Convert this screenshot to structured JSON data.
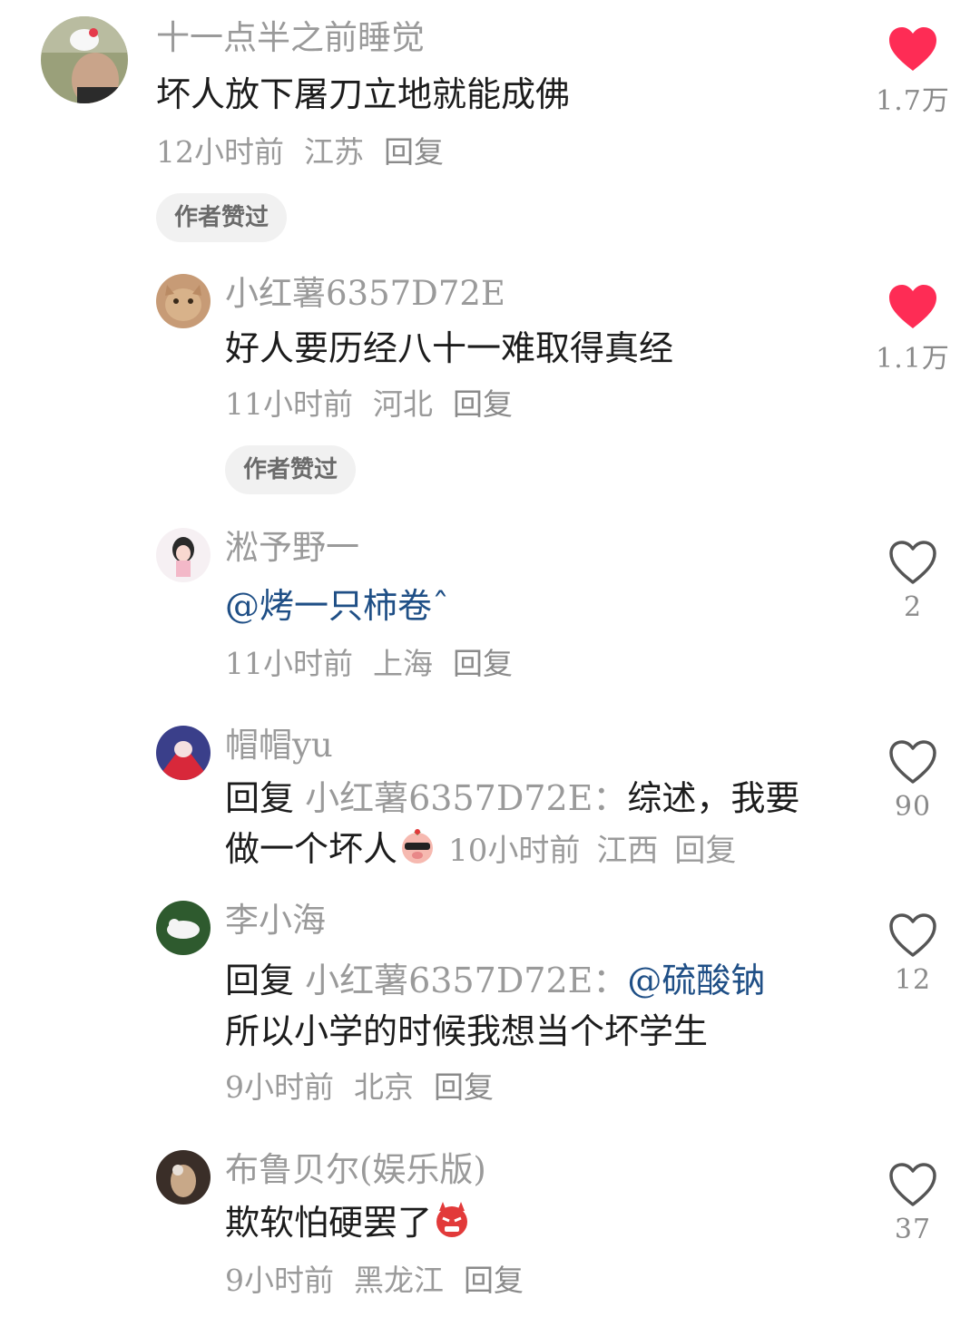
{
  "comments": [
    {
      "username": "十一点半之前睡觉",
      "text": "坏人放下屠刀立地就能成佛",
      "time": "12小时前",
      "location": "江苏",
      "reply": "回复",
      "badge": "作者赞过",
      "likes": "1.7万",
      "liked": true
    },
    {
      "username": "小红薯6357D72E",
      "text": "好人要历经八十一难取得真经",
      "time": "11小时前",
      "location": "河北",
      "reply": "回复",
      "badge": "作者赞过",
      "likes": "1.1万",
      "liked": true
    },
    {
      "username": "淞予野一",
      "mention": "@烤一只柿卷ˆ",
      "time": "11小时前",
      "location": "上海",
      "reply": "回复",
      "likes": "2",
      "liked": false
    },
    {
      "username": "帽帽yu",
      "reply_prefix": "回复",
      "reply_target": "小红薯6357D72E：",
      "text_line1": "综述，我要",
      "text_line2": "做一个坏人",
      "emoji": "sunglasses-pig-emoji",
      "time": "10小时前",
      "location": "江西",
      "reply": "回复",
      "likes": "90",
      "liked": false
    },
    {
      "username": "李小海",
      "reply_prefix": "回复",
      "reply_target": "小红薯6357D72E：",
      "mention": "@硫酸钠",
      "text_line2": "所以小学的时候我想当个坏学生",
      "time": "9小时前",
      "location": "北京",
      "reply": "回复",
      "likes": "12",
      "liked": false
    },
    {
      "username": "布鲁贝尔(娱乐版)",
      "text": "欺软怕硬罢了",
      "emoji": "angry-devil-emoji",
      "time": "9小时前",
      "location": "黑龙江",
      "reply": "回复",
      "likes": "37",
      "liked": false
    }
  ],
  "colors": {
    "liked": "#fe2c55",
    "icon_outline": "#555555",
    "muted_text": "#9a9a9a",
    "mention": "#1f4f86",
    "badge_bg": "#f1f1f1"
  }
}
